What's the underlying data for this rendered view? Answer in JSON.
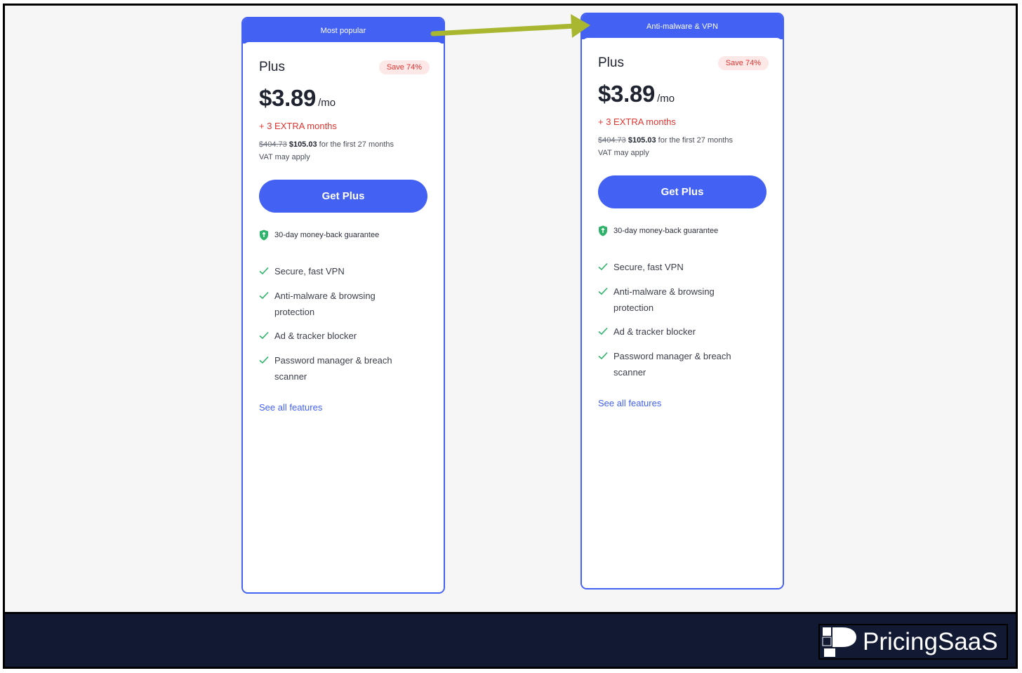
{
  "cards": [
    {
      "banner": "Most popular",
      "plan": "Plus",
      "badge": "Save 74%",
      "price": "$3.89",
      "period": "/mo",
      "extra": "+ 3 EXTRA months",
      "old_price": "$404.73",
      "new_price": "$105.03",
      "term": "for the first 27 months",
      "vat": "VAT may apply",
      "cta": "Get Plus",
      "guarantee": "30-day money-back guarantee",
      "features": [
        "Secure, fast VPN",
        "Anti-malware & browsing protection",
        "Ad & tracker blocker",
        "Password manager & breach scanner"
      ],
      "see_all": "See all features"
    },
    {
      "banner": "Anti-malware & VPN",
      "plan": "Plus",
      "badge": "Save 74%",
      "price": "$3.89",
      "period": "/mo",
      "extra": "+ 3 EXTRA months",
      "old_price": "$404.73",
      "new_price": "$105.03",
      "term": "for the first 27 months",
      "vat": "VAT may apply",
      "cta": "Get Plus",
      "guarantee": "30-day money-back guarantee",
      "features": [
        "Secure, fast VPN",
        "Anti-malware & browsing protection",
        "Ad & tracker blocker",
        "Password manager & breach scanner"
      ],
      "see_all": "See all features"
    }
  ],
  "footer": {
    "logo_text": "PricingSaaS"
  },
  "colors": {
    "accent": "#4361f2",
    "sale_red": "#e0342f",
    "footer_bg": "#121a33",
    "arrow": "#a8b72f",
    "shield_green": "#2fb36a"
  },
  "icons": {
    "arrow": "arrow-right-icon",
    "check": "check-icon",
    "shield": "shield-icon",
    "logo": "pricingsaas-logo-icon"
  }
}
